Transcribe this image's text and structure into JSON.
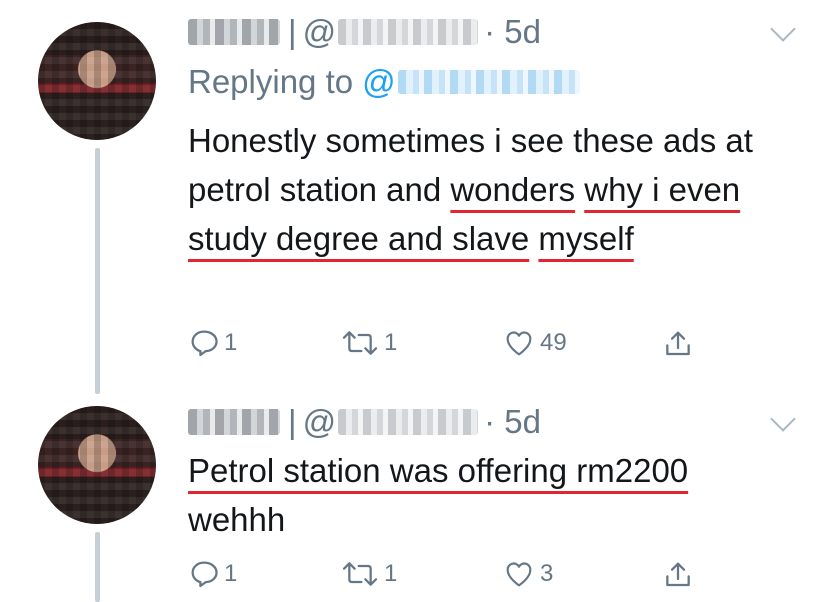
{
  "tweets": [
    {
      "separator": "|",
      "at": "@",
      "dot_time": "· 5d",
      "replying_prefix": "Replying to",
      "replying_at": "@",
      "text_plain": "Honestly sometimes i see these ads at petrol station and ",
      "text_highlight_1": "wonders",
      "text_highlight_2": "why i even study degree and slave",
      "text_highlight_3": "myself",
      "reply_count": "1",
      "retweet_count": "1",
      "like_count": "49"
    },
    {
      "separator": "|",
      "at": "@",
      "dot_time": "· 5d",
      "text_highlight": "Petrol station was offering rm2200",
      "text_plain": "wehhh",
      "reply_count": "1",
      "retweet_count": "1",
      "like_count": "3"
    }
  ],
  "icons": {
    "reply": "reply-icon",
    "retweet": "retweet-icon",
    "like": "heart-icon",
    "share": "share-icon",
    "menu": "chevron-down-icon"
  },
  "colors": {
    "secondary_text": "#657786",
    "link": "#1da1f2",
    "underline_annotation": "#e0262e",
    "thread_line": "#c4cfd6"
  }
}
